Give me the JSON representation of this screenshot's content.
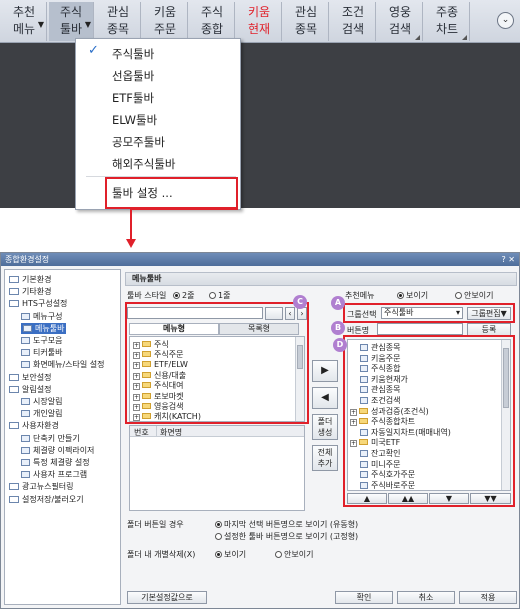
{
  "toolbar": {
    "items": [
      {
        "line1": "추천",
        "line2": "메뉴",
        "red": false,
        "dropdown": true
      },
      {
        "line1": "주식",
        "line2": "툴바",
        "red": false,
        "dropdown": true,
        "active": true
      },
      {
        "line1": "관심",
        "line2": "종목",
        "red": false
      },
      {
        "line1": "키움",
        "line2": "주문",
        "red": false
      },
      {
        "line1": "주식",
        "line2": "종합",
        "red": false
      },
      {
        "line1": "키움",
        "line2": "현재",
        "red": true
      },
      {
        "line1": "관심",
        "line2": "종목",
        "red": false
      },
      {
        "line1": "조건",
        "line2": "검색",
        "red": false
      },
      {
        "line1": "영웅",
        "line2": "검색",
        "red": false,
        "corner": true
      },
      {
        "line1": "주종",
        "line2": "차트",
        "red": false,
        "corner": true
      }
    ],
    "more_icon": "chevron-down-circle-icon",
    "more_glyph": "⌄"
  },
  "dropdown": {
    "items": [
      "주식툴바",
      "선옵툴바",
      "ETF툴바",
      "ELW툴바",
      "공모주툴바",
      "해외주식툴바"
    ],
    "checked_index": 0,
    "check_glyph": "✓",
    "settings": "툴바 설정 ..."
  },
  "dialog": {
    "title": "종합환경설정",
    "controls": "? ✕",
    "tree": [
      {
        "label": "기본환경",
        "level": 0,
        "type": "folder"
      },
      {
        "label": "기타환경",
        "level": 0,
        "type": "folder"
      },
      {
        "label": "HTS구성설정",
        "level": 0,
        "type": "folder"
      },
      {
        "label": "메뉴구성",
        "level": 1,
        "type": "page"
      },
      {
        "label": "메뉴툴바",
        "level": 1,
        "type": "page",
        "selected": true
      },
      {
        "label": "도구모음",
        "level": 1,
        "type": "page"
      },
      {
        "label": "티커툴바",
        "level": 1,
        "type": "page"
      },
      {
        "label": "화면메뉴/스타일 설정",
        "level": 1,
        "type": "page"
      },
      {
        "label": "보안설정",
        "level": 0,
        "type": "folder"
      },
      {
        "label": "알림설정",
        "level": 0,
        "type": "folder"
      },
      {
        "label": "시장알림",
        "level": 1,
        "type": "page"
      },
      {
        "label": "개인알림",
        "level": 1,
        "type": "page"
      },
      {
        "label": "사용자환경",
        "level": 0,
        "type": "folder"
      },
      {
        "label": "단축키 만들기",
        "level": 1,
        "type": "page"
      },
      {
        "label": "체결량 이펙라이저",
        "level": 1,
        "type": "page"
      },
      {
        "label": "특정 체결량 설정",
        "level": 1,
        "type": "page"
      },
      {
        "label": "사용자 프로그램",
        "level": 1,
        "type": "page"
      },
      {
        "label": "광고뉴스필터링",
        "level": 0,
        "type": "folder"
      },
      {
        "label": "설정저장/불러오기",
        "level": 0,
        "type": "folder"
      }
    ],
    "section_title": "메뉴툴바",
    "toolbar_style_label": "툴바 스타일",
    "style_options": [
      "2줄",
      "1줄"
    ],
    "style_selected": 0,
    "recommend_label": "추천메뉴",
    "recommend_options": [
      "보이기",
      "안보이기"
    ],
    "recommend_selected": 0,
    "group_select_label": "그룹선택",
    "group_select_value": "주식툴바",
    "group_edit_button": "그룹편집▼",
    "button_name_label": "버튼명",
    "register_button": "등록",
    "tabs": [
      "메뉴형",
      "목록형"
    ],
    "active_tab": 0,
    "tree_items": [
      "주식",
      "주식주문",
      "ETF/ELW",
      "신용/대출",
      "주식대여",
      "로보마켓",
      "영웅검색",
      "캐치(KATCH)"
    ],
    "list_header": [
      "번호",
      "화면명"
    ],
    "right_items": [
      {
        "label": "관심종목",
        "type": "page"
      },
      {
        "label": "키움주문",
        "type": "page"
      },
      {
        "label": "주식종합",
        "type": "page"
      },
      {
        "label": "키움현재가",
        "type": "page"
      },
      {
        "label": "관심종목",
        "type": "page"
      },
      {
        "label": "조건검색",
        "type": "page"
      },
      {
        "label": "성과검증(조건식)",
        "type": "folder"
      },
      {
        "label": "주식종합차트",
        "type": "folder"
      },
      {
        "label": "자동일지차트(매매내역)",
        "type": "page"
      },
      {
        "label": "미국ETF",
        "type": "folder"
      },
      {
        "label": "잔고확인",
        "type": "page"
      },
      {
        "label": "미니주문",
        "type": "page"
      },
      {
        "label": "주식호가주문",
        "type": "page"
      },
      {
        "label": "주식바로주문",
        "type": "page"
      }
    ],
    "arrow_right": "▶",
    "arrow_left": "◀",
    "folder_create": "폴더\n생성",
    "all_add": "전체\n추가",
    "order_buttons": [
      "▲",
      "▲▲",
      "▼",
      "▼▼"
    ],
    "folder_button_label": "폴더 버튼일 경우",
    "folder_options": [
      "마지막 선택 버튼명으로 보이기 (유동형)",
      "설정한 툴바 버튼명으로 보이기 (고정형)"
    ],
    "folder_selected": 0,
    "delete_label": "폴더 내 개별삭제(X)",
    "delete_options": [
      "보이기",
      "안보이기"
    ],
    "delete_selected": 0,
    "markers": [
      "A",
      "B",
      "C",
      "D"
    ],
    "footer": {
      "defaults": "기본설정값으로",
      "ok": "확인",
      "cancel": "취소",
      "apply": "적용"
    }
  }
}
